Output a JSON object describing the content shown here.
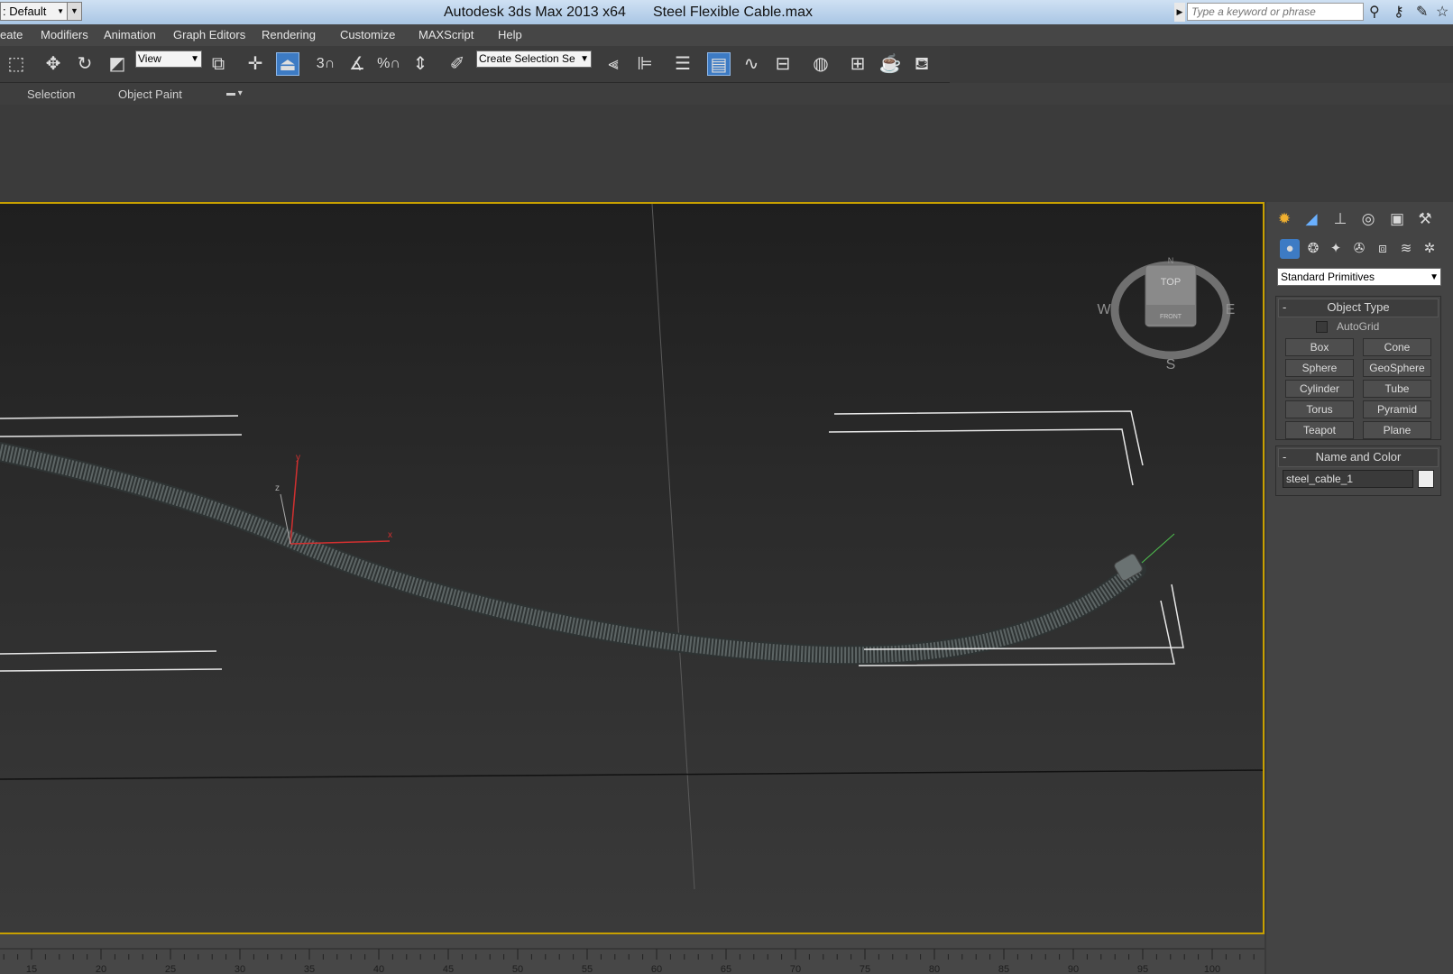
{
  "titlebar": {
    "workspace": ": Default",
    "app_title": "Autodesk 3ds Max  2013 x64",
    "file_name": "Steel Flexible Cable.max",
    "search_placeholder": "Type a keyword or phrase",
    "icons": [
      "binoculars-icon",
      "key-icon",
      "signin-icon",
      "star-icon"
    ]
  },
  "menu": {
    "items": [
      "eate",
      "Modifiers",
      "Animation",
      "Graph Editors",
      "Rendering",
      "Customize",
      "MAXScript",
      "Help"
    ]
  },
  "toolbar": {
    "reference_coord": "View",
    "selection_set": "Create Selection Se",
    "snap_label": "3"
  },
  "ribbon": {
    "tabs": [
      "Selection",
      "Object Paint"
    ]
  },
  "viewcube": {
    "top_label": "TOP",
    "front_label": "FRONT",
    "west_label": "W",
    "east_label": "E",
    "south_label": "S",
    "north_label": "N"
  },
  "gizmo": {
    "x": "x",
    "y": "y",
    "z": "z"
  },
  "command_panel": {
    "category": "Standard Primitives",
    "object_type": {
      "header": "Object Type",
      "collapse": "-",
      "autogrid": "AutoGrid",
      "buttons": [
        "Box",
        "Cone",
        "Sphere",
        "GeoSphere",
        "Cylinder",
        "Tube",
        "Torus",
        "Pyramid",
        "Teapot",
        "Plane"
      ]
    },
    "name_and_color": {
      "header": "Name and Color",
      "collapse": "-",
      "name": "steel_cable_1",
      "color": "#eeeeee"
    }
  },
  "timeline": {
    "ticks": [
      "15",
      "20",
      "25",
      "30",
      "35",
      "40",
      "45",
      "50",
      "55",
      "60",
      "65",
      "70",
      "75",
      "80",
      "85",
      "90",
      "95",
      "100"
    ]
  },
  "colors": {
    "accent": "#3d7bc4",
    "viewport_border": "#c8a000"
  }
}
